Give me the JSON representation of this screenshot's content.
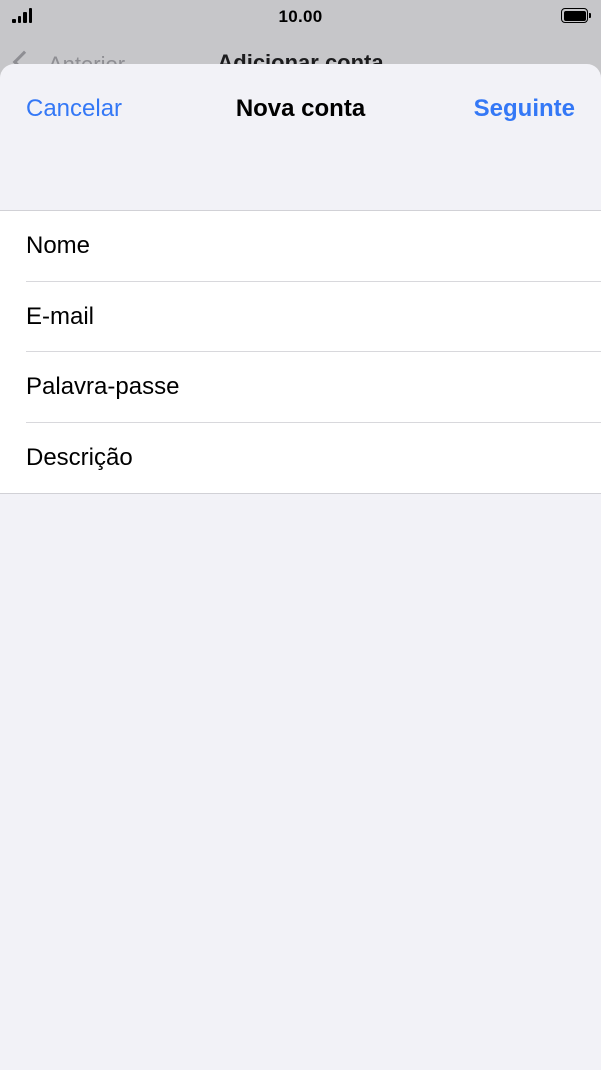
{
  "status_bar": {
    "time": "10.00",
    "signal_icon": "signal-bars-icon",
    "battery_icon": "battery-full-icon"
  },
  "background_nav": {
    "back_label": "Anterior",
    "title": "Adicionar conta",
    "back_icon": "chevron-left-icon"
  },
  "sheet": {
    "nav": {
      "cancel_label": "Cancelar",
      "title": "Nova conta",
      "next_label": "Seguinte"
    },
    "fields": [
      {
        "placeholder": "Nome",
        "value": ""
      },
      {
        "placeholder": "E-mail",
        "value": ""
      },
      {
        "placeholder": "Palavra-passe",
        "value": ""
      },
      {
        "placeholder": "Descrição",
        "value": ""
      }
    ]
  },
  "colors": {
    "accent": "#3478f6",
    "sheet_background": "#f2f2f7",
    "dimmed_background": "#c6c6c9",
    "separator": "#d8d8dc"
  }
}
